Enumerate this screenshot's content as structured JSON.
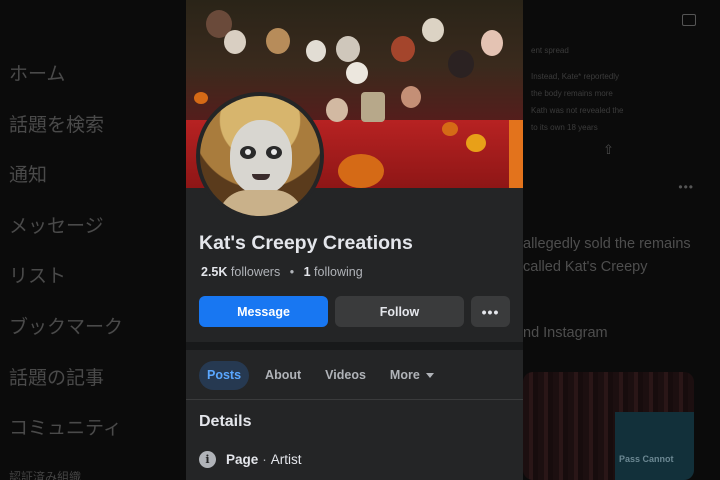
{
  "background": {
    "nav_items": [
      "ホーム",
      "話題を検索",
      "通知",
      "メッセージ",
      "リスト",
      "ブックマーク",
      "話題の記事",
      "コミュニティ"
    ],
    "nav_last": "認証済み組織",
    "right_column": {
      "tiny_lines": [
        "ent spread",
        "Instead, Kate* reportedly",
        "the body remains more",
        "Kath was not revealed the",
        "to its own 18 years"
      ],
      "big_lines": [
        "allegedly sold the remains",
        "called Kat's Creepy",
        "nd Instagram"
      ],
      "thumb_text": "Pass Cannot"
    }
  },
  "page": {
    "name": "Kat's Creepy Creations",
    "followers_count": "2.5K",
    "followers_label": "followers",
    "following_count": "1",
    "following_label": "following",
    "separator": "•"
  },
  "actions": {
    "message": "Message",
    "follow": "Follow",
    "more": "•••"
  },
  "tabs": [
    {
      "label": "Posts",
      "active": true
    },
    {
      "label": "About",
      "active": false
    },
    {
      "label": "Videos",
      "active": false
    },
    {
      "label": "More",
      "active": false
    }
  ],
  "details": {
    "title": "Details",
    "category_label": "Page",
    "category_value": "Artist"
  },
  "colors": {
    "accent": "#1877f2",
    "card_bg": "#242526",
    "active_tab_bg": "#263951",
    "active_tab_text": "#5aa7ff"
  }
}
